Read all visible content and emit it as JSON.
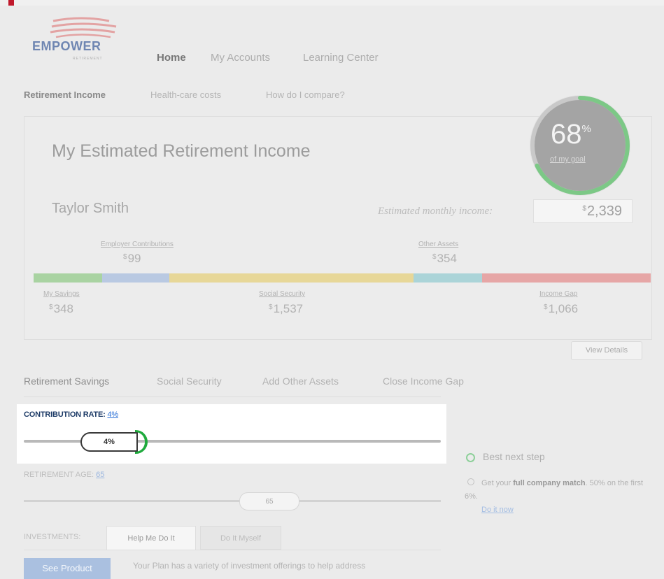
{
  "brand": {
    "name": "EMPOWER",
    "sub": "RETIREMENT"
  },
  "nav": {
    "items": [
      "Home",
      "My Accounts",
      "Learning Center"
    ],
    "active": "Home"
  },
  "subnav": {
    "items": [
      "Retirement Income",
      "Health-care costs",
      "How do I compare?"
    ],
    "active": "Retirement Income"
  },
  "summary": {
    "title": "My Estimated Retirement Income",
    "user_name": "Taylor Smith",
    "estimated_label": "Estimated monthly income:",
    "estimated_currency": "$",
    "estimated_value": "2,339",
    "goal_percent": "68",
    "goal_percent_sign": "%",
    "goal_fraction": 0.68,
    "goal_label": "of my goal"
  },
  "breakdown": {
    "employer": {
      "label": "Employer Contributions",
      "currency": "$",
      "value": "99",
      "color": "#b9c9e2"
    },
    "other": {
      "label": "Other Assets",
      "currency": "$",
      "value": "354",
      "color": "#abd4d8"
    },
    "savings": {
      "label": "My Savings",
      "currency": "$",
      "value": "348",
      "color": "#a9d3a2"
    },
    "social": {
      "label": "Social Security",
      "currency": "$",
      "value": "1,537",
      "color": "#e7d798"
    },
    "gap": {
      "label": "Income Gap",
      "currency": "$",
      "value": "1,066",
      "color": "#e6a6a6"
    }
  },
  "view_details": "View Details",
  "tabs": {
    "items": [
      "Retirement Savings",
      "Social Security",
      "Add Other Assets",
      "Close Income Gap"
    ],
    "active": "Retirement Savings"
  },
  "contribution": {
    "label": "CONTRIBUTION RATE:",
    "value": "4%",
    "handle": "4%"
  },
  "retirement_age": {
    "label": "RETIREMENT AGE:",
    "value": "65",
    "handle": "65"
  },
  "investments": {
    "label": "INVESTMENTS:",
    "options": [
      "Help Me Do It",
      "Do It Myself"
    ],
    "selected": "Help Me Do It"
  },
  "see_product": "See Product",
  "plan_text": "Your Plan has a variety of investment offerings to help address",
  "best_next_step": {
    "title": "Best next step",
    "prefix": "Get your ",
    "bold": "full company match",
    "suffix": ". 50% on the first 6%.",
    "link": "Do it now"
  },
  "colors": {
    "accent": "#1faa3d",
    "brand_red": "#c0182b",
    "link_blue": "#2a6fd6"
  }
}
